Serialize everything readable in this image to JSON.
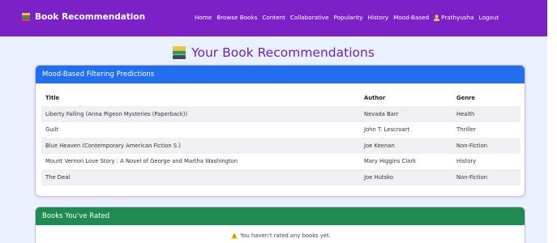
{
  "navbar": {
    "brand": "Book Recommendation",
    "links": [
      "Home",
      "Browse Books",
      "Content",
      "Collaborative",
      "Popularity",
      "History",
      "Mood-Based"
    ],
    "user": "Prathyusha",
    "logout": "Logout"
  },
  "page_title": "Your Book Recommendations",
  "mood_card": {
    "title": "Mood-Based Filtering Predictions",
    "columns": [
      "Title",
      "Author",
      "Genre"
    ],
    "rows": [
      [
        "Liberty Falling (Anna Pigeon Mysteries (Paperback))",
        "Nevada Barr",
        "Health"
      ],
      [
        "Guilt",
        "John T. Lescroart",
        "Thriller"
      ],
      [
        "Blue Heaven (Contemporary American Fiction S.)",
        "Joe Keenan",
        "Non-Fiction"
      ],
      [
        "Mount Vernon Love Story : A Novel of George and Martha Washington",
        "Mary Higgins Clark",
        "History"
      ],
      [
        "The Deal",
        "Joe Hutsko",
        "Non-Fiction"
      ]
    ]
  },
  "rated_card": {
    "title": "Books You've Rated",
    "empty_message": "You haven't rated any books yet."
  },
  "colors": {
    "navbar": "#7b21c8",
    "mood_header": "#1f6ff0",
    "rated_header": "#1e8b50",
    "heading_text": "#6f1fc0"
  },
  "icons": {
    "brand": "books-icon",
    "heading": "books-icon",
    "user": "user-icon",
    "warning": "warning-icon"
  }
}
